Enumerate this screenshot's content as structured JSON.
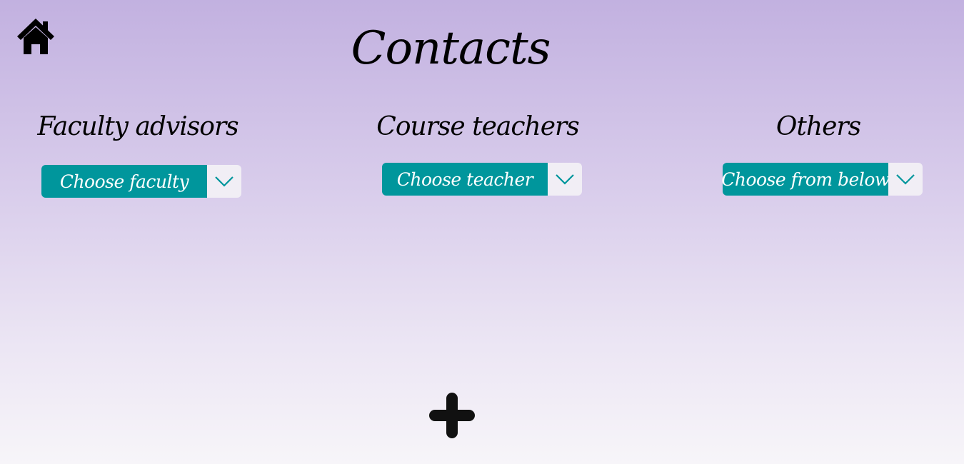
{
  "page": {
    "title": "Contacts"
  },
  "nav": {
    "home_icon": "home-icon"
  },
  "sections": [
    {
      "heading": "Faculty advisors",
      "dropdown_label": "Choose faculty",
      "toggle_icon": "chevron-down-icon"
    },
    {
      "heading": "Course teachers",
      "dropdown_label": "Choose teacher",
      "toggle_icon": "chevron-down-icon"
    },
    {
      "heading": "Others",
      "dropdown_label": "Choose from below",
      "toggle_icon": "chevron-down-icon"
    }
  ],
  "actions": {
    "add_icon": "plus-icon"
  },
  "colors": {
    "accent": "#00969c",
    "background_top": "#c2b1e0",
    "background_bottom": "#f7f5f9",
    "icon": "#111111"
  }
}
